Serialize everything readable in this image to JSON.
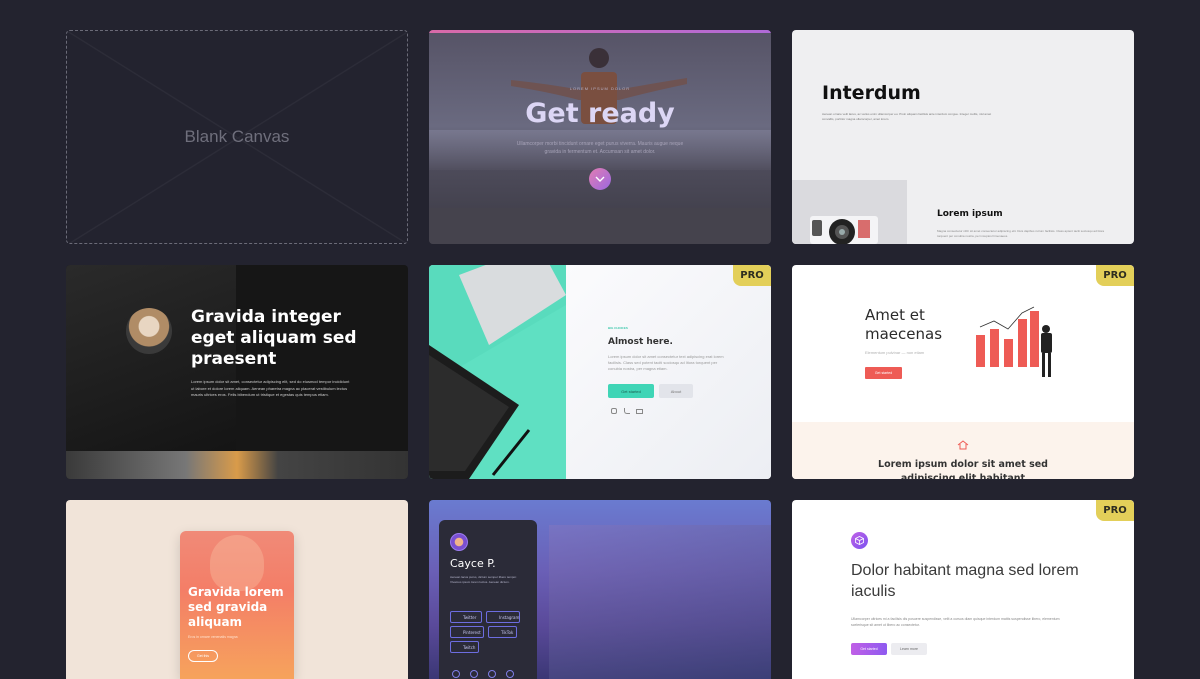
{
  "blank": {
    "label": "Blank Canvas"
  },
  "get_ready": {
    "eyebrow": "LOREM IPSUM DOLOR",
    "title": "Get ready",
    "body": "Ullamcorper morbi tincidunt ornare eget purus viverra. Mauris augue neque gravida in fermentum et. Accumsan sit amet dolor.",
    "accent": "#e46fae"
  },
  "interdum": {
    "title": "Interdum",
    "body": "Aenean ornare velit lacus, ac varius enim ullamcorper eu. Proin aliquam facilisis ante interdum congue. Integer mollis, nisl amet convallis, porttitor magna ullamcorper, amet lorem.",
    "subtitle": "Lorem ipsum",
    "subbody": "Magna consectetur nibh sit amet consectetur adipiscing elit. Duis dapibus rutrum facilisis. Class aptent taciti sociosqu ad litora torquent per conubia nostra, per inceptos himenaeos."
  },
  "gravida_dark": {
    "title": "Gravida integer eget aliquam sed praesent",
    "body": "Lorem ipsum dolor sit amet, consectetur adipiscing elit, sed do eiusmod tempor incididunt ut labore et dolore lorem aliquam. Aenean pharetra magna ac placerat vestibulum lectus mauris ultrices eros. Felis bibendum ut tristique et egestas quis tempus etiam."
  },
  "almost_here": {
    "badge": "PRO",
    "eyebrow": "BIG CHOICES",
    "title": "Almost here.",
    "body": "Lorem ipsum dolor sit amet consectetur text adipiscing erat lorem facilisis. Class sed potent taciti sociosqu ad litora torquent per conubia nostra, per magna etiam.",
    "primary_label": "Get started",
    "secondary_label": "About",
    "accent": "#3fd5b6"
  },
  "amet": {
    "badge": "PRO",
    "title": "Amet et maecenas",
    "subtitle": "Elementum pulvinar — non etiam",
    "button_label": "Get started",
    "footer_title": "Lorem ipsum dolor sit amet sed adipiscing elit habitant",
    "accent": "#ee5b55"
  },
  "gravida_card": {
    "title": "Gravida lorem sed gravida aliquam",
    "subtitle": "Eros in ornare venenatis magna",
    "button_label": "Get this"
  },
  "cayce": {
    "name": "Cayce P.",
    "bio": "Aenean lacus purus, dictum semper libero tempor. Vivamus ipsum lorem luctus. Aenean dictum.",
    "links": [
      "Twitter",
      "Instagram",
      "Pinterest",
      "TikTok",
      "Twitch"
    ],
    "accent": "#6d6de0"
  },
  "dolor": {
    "badge": "PRO",
    "title": "Dolor habitant magna sed lorem iaculis",
    "body": "Ullamcorper ultrices mi a facilisis dis posuere suspendisse, velit a cursus diam quisque interdum mattis suspendisse libero, elementum scelerisque sit amet ut libero ac consectetur.",
    "primary_label": "Get started",
    "secondary_label": "Learn more",
    "accent": "#9c5bf2"
  }
}
